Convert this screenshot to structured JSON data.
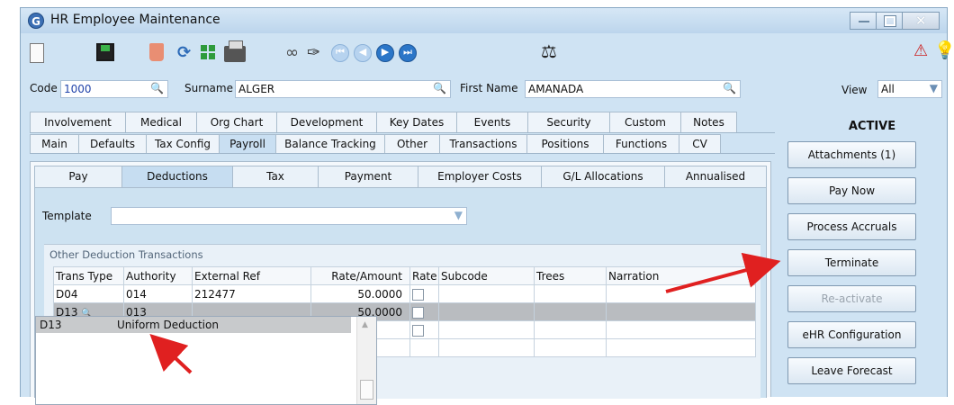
{
  "window": {
    "app_icon": "G",
    "title": "HR Employee Maintenance"
  },
  "toolbar": {
    "icons": [
      "new-icon",
      "save-icon",
      "delete-icon",
      "refresh-icon",
      "tree-icon",
      "print-icon",
      "binoculars-icon",
      "wand-icon",
      "first-icon",
      "prev-icon",
      "next-icon",
      "last-icon",
      "scales-icon",
      "warning-icon",
      "bulb-icon"
    ]
  },
  "header": {
    "code_label": "Code",
    "code_value": "1000",
    "surname_label": "Surname",
    "surname_value": "ALGER",
    "firstname_label": "First Name",
    "firstname_value": "AMANADA",
    "view_label": "View",
    "view_value": "All"
  },
  "tabs_row1": [
    "Involvement",
    "Medical",
    "Org Chart",
    "Development",
    "Key Dates",
    "Events",
    "Security",
    "Custom",
    "Notes"
  ],
  "tabs_row2": [
    "Main",
    "Defaults",
    "Tax Config",
    "Payroll",
    "Balance Tracking",
    "Other",
    "Transactions",
    "Positions",
    "Functions",
    "CV"
  ],
  "subtabs": [
    "Pay",
    "Deductions",
    "Tax",
    "Payment",
    "Employer Costs",
    "G/L Allocations",
    "Annualised"
  ],
  "template": {
    "label": "Template",
    "value": ""
  },
  "section_title": "Other Deduction Transactions",
  "grid": {
    "headers": [
      "Trans Type",
      "Authority",
      "External Ref",
      "Rate/Amount",
      "Rate",
      "Subcode",
      "Trees",
      "Narration"
    ],
    "rows": [
      {
        "trans_type": "D04",
        "authority": "014",
        "external_ref": "212477",
        "rate_amount": "50.0000"
      },
      {
        "trans_type": "D13",
        "authority": "013",
        "external_ref": "",
        "rate_amount": "50.0000"
      }
    ]
  },
  "dropdown": {
    "code": "D13",
    "description": "Uniform Deduction"
  },
  "side": {
    "status": "ACTIVE",
    "buttons": [
      "Attachments (1)",
      "Pay Now",
      "Process Accruals",
      "Terminate",
      "Re-activate",
      "eHR Configuration",
      "Leave Forecast"
    ]
  },
  "colors": {
    "arrow": "#e02020",
    "selected_row": "#b9bcc0",
    "accent_nav": "#2b76c8"
  }
}
